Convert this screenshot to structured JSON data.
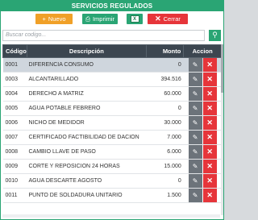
{
  "title": "SERVICIOS REGULADOS",
  "toolbar": {
    "nuevo": "Nuevo",
    "imprimir": "Imprimir",
    "excel_icon": "excel-icon",
    "cerrar": "Cerrar"
  },
  "search": {
    "placeholder": "Buscar codigo..."
  },
  "table": {
    "headers": [
      "Código",
      "Descripción",
      "Monto",
      "Accion"
    ],
    "rows": [
      {
        "code": "0001",
        "desc": "DIFERENCIA CONSUMO",
        "monto": "0"
      },
      {
        "code": "0003",
        "desc": "ALCANTARILLADO",
        "monto": "394.516"
      },
      {
        "code": "0004",
        "desc": "DERECHO A MATRIZ",
        "monto": "60.000"
      },
      {
        "code": "0005",
        "desc": "AGUA POTABLE FEBRERO",
        "monto": "0"
      },
      {
        "code": "0006",
        "desc": "NICHO DE MEDIDOR",
        "monto": "30.000"
      },
      {
        "code": "0007",
        "desc": "CERTIFICADO FACTIBILIDAD DE DACION",
        "monto": "7.000"
      },
      {
        "code": "0008",
        "desc": "CAMBIO LLAVE DE PASO",
        "monto": "6.000"
      },
      {
        "code": "0009",
        "desc": "CORTE Y REPOSICION 24 HORAS",
        "monto": "15.000"
      },
      {
        "code": "0010",
        "desc": "AGUA DESCARTE AGOSTO",
        "monto": "0"
      },
      {
        "code": "0011",
        "desc": "PUNTO DE SOLDADURA UNITARIO",
        "monto": "1.500"
      }
    ],
    "selected_row": 0
  },
  "colors": {
    "accent": "#2aa574",
    "nuevo": "#f0a028",
    "danger": "#e6353a",
    "header": "#3c4650"
  }
}
